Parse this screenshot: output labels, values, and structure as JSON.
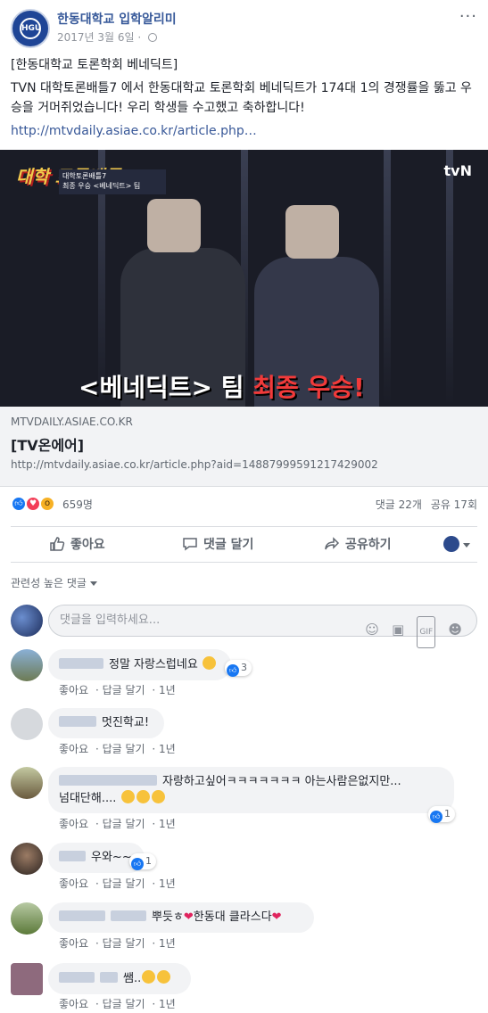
{
  "header": {
    "page_name": "한동대학교 입학알리미",
    "date": "2017년 3월 6일 · ",
    "more": "···",
    "logo_text": "HGU"
  },
  "post": {
    "title_line": "[한동대학교 토론학회 베네딕트]",
    "body": "TVN 대학토론배틀7 에서 한동대학교 토론학회 베네딕트가 174대 1의 경쟁률을 뚫고 우승을 거머쥐었습니다! 우리 학생들 수고했고 축하합니다!",
    "link_text": "http://mtvdaily.asiae.co.kr/article.php…"
  },
  "preview": {
    "show_title": "대학 토론배틀7",
    "show_sub_1": "대학토론배틀7",
    "show_sub_2": "최종 우승 <베네딕트> 팀",
    "channel": "tvN",
    "caption_white": "<베네딕트> 팀 ",
    "caption_red": "최종 우승!",
    "domain": "MTVDAILY.ASIAE.CO.KR",
    "title": "[TV온에어]",
    "url": "http://mtvdaily.asiae.co.kr/article.php?aid=14887999591217429002"
  },
  "stats": {
    "reaction_count": "659명",
    "comments": "댓글 22개",
    "shares": "공유 17회"
  },
  "actions": {
    "like": "좋아요",
    "comment": "댓글 달기",
    "share": "공유하기"
  },
  "sort_label": "관련성 높은 댓글",
  "composer": {
    "placeholder": "댓글을 입력하세요..."
  },
  "comments": [
    {
      "text": "정말 자랑스럽네요",
      "reactions": "3",
      "like": "좋아요",
      "reply": "답글 달기",
      "time": "1년"
    },
    {
      "text": "멋진학교!",
      "like": "좋아요",
      "reply": "답글 달기",
      "time": "1년"
    },
    {
      "text": "자랑하고싶어ㅋㅋㅋㅋㅋㅋㅋ 아는사람은없지만...",
      "text2": "넘대단해....",
      "reactions": "1",
      "like": "좋아요",
      "reply": "답글 달기",
      "time": "1년"
    },
    {
      "text": "우와~~",
      "reactions": "1",
      "like": "좋아요",
      "reply": "답글 달기",
      "time": "1년"
    },
    {
      "text": "뿌듯ㅎ",
      "text_b": "한동대 클라스다",
      "like": "좋아요",
      "reply": "답글 달기",
      "time": "1년"
    },
    {
      "text": "쌤..",
      "like": "좋아요",
      "reply": "답글 달기",
      "time": "1년"
    }
  ],
  "colors": {
    "link": "#385898",
    "name": "#365899",
    "like_blue": "#1877f2",
    "love_red": "#f33e58"
  }
}
